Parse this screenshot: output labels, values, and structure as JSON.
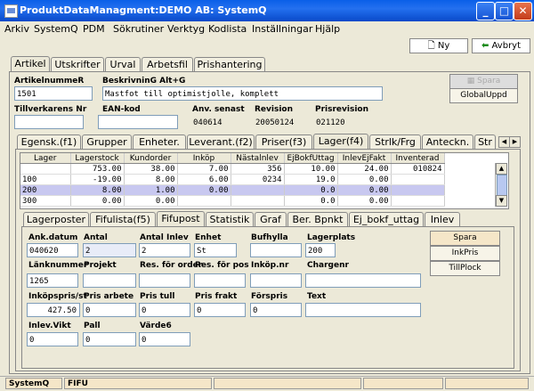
{
  "window": {
    "title": "ProduktDataManagment:DEMO AB: SystemQ"
  },
  "menu": [
    "Arkiv",
    "SystemQ",
    "PDM",
    "Sökrutiner",
    "Verktyg",
    "Kodlista",
    "Inställningar",
    "Hjälp"
  ],
  "toolbar": {
    "new_label": "Ny",
    "cancel_label": "Avbryt"
  },
  "main_tabs": [
    "Artikel",
    "Utskrifter",
    "Urval",
    "Arbetsfil",
    "Prishantering"
  ],
  "article": {
    "artnr_label": "ArtikelnummeR",
    "artnr_value": "1501",
    "desc_label": "BeskrivninG Alt+G",
    "desc_value": "Mastfot till optimistjolle, komplett",
    "tillv_label": "Tillverkarens Nr",
    "tillv_value": "",
    "ean_label": "EAN-kod",
    "ean_value": "",
    "anv_label": "Anv. senast",
    "anv_value": "040614",
    "rev_label": "Revision",
    "rev_value": "20050124",
    "prisrev_label": "Prisrevision",
    "prisrev_value": "021120",
    "spara_label": "Spara",
    "global_label": "GlobalUppd"
  },
  "sub_tabs": [
    "Egensk.(f1)",
    "Grupper",
    "Enheter.",
    "Leverant.(f2)",
    "Priser(f3)",
    "Lager(f4)",
    "Strlk/Frg",
    "Anteckn.",
    "Str"
  ],
  "lager_grid": {
    "headers": [
      "Lager",
      "Lagerstock",
      "Kundorder",
      "Inköp",
      "Nästalnlev",
      "EjBokfUttag",
      "InlevEjFakt",
      "Inventerad"
    ],
    "rows": [
      [
        "",
        "753.00",
        "38.00",
        "7.00",
        "356",
        "10.00",
        "24.00",
        "010824"
      ],
      [
        "100",
        "-19.00",
        "8.00",
        "6.00",
        "0234",
        "19.0",
        "0.00",
        ""
      ],
      [
        "200",
        "8.00",
        "1.00",
        "0.00",
        "",
        "0.0",
        "0.00",
        ""
      ],
      [
        "300",
        "0.00",
        "0.00",
        "",
        "",
        "0.0",
        "0.00",
        ""
      ]
    ]
  },
  "inner_tabs": [
    "Lagerposter",
    "Fifulista(f5)",
    "Fifupost",
    "Statistik",
    "Graf",
    "Ber. Bpnkt",
    "Ej_bokf_uttag",
    "Inlev"
  ],
  "fifu": {
    "ank_label": "Ank.datum",
    "ank_value": "040620",
    "antal_label": "Antal",
    "antal_value": "2",
    "antinlev_label": "Antal Inlev",
    "antinlev_value": "2",
    "enhet_label": "Enhet",
    "enhet_value": "St",
    "bufhylla_label": "Bufhylla",
    "bufhylla_value": "",
    "lagerplats_label": "Lagerplats",
    "lagerplats_value": "200",
    "lankn_label": "Länknummer",
    "lankn_value": "1265",
    "projekt_label": "Projekt",
    "projekt_value": "",
    "resorder_label": "Res. för order",
    "resorder_value": "",
    "respos_label": "Res. för pos",
    "respos_value": "",
    "inkopnr_label": "Inköp.nr",
    "inkopnr_value": "",
    "chargenr_label": "Chargenr",
    "chargenr_value": "",
    "inkopspris_label": "Inköpspris/st",
    "inkopspris_value": "427.50",
    "prisarb_label": "Pris arbete",
    "prisarb_value": "0",
    "pristull_label": "Pris tull",
    "pristull_value": "0",
    "prisfrakt_label": "Pris frakt",
    "prisfrakt_value": "0",
    "forspris_label": "Förspris",
    "forspris_value": "0",
    "text_label": "Text",
    "text_value": "",
    "inlevvikt_label": "Inlev.Vikt",
    "inlevvikt_value": "0",
    "pall_label": "Pall",
    "pall_value": "0",
    "varde6_label": "Värde6",
    "varde6_value": "0",
    "spara_label": "Spara",
    "inkpris_label": "InkPris",
    "tillplock_label": "TillPlock"
  },
  "status": {
    "left": "SystemQ",
    "mid": "FIFU"
  }
}
